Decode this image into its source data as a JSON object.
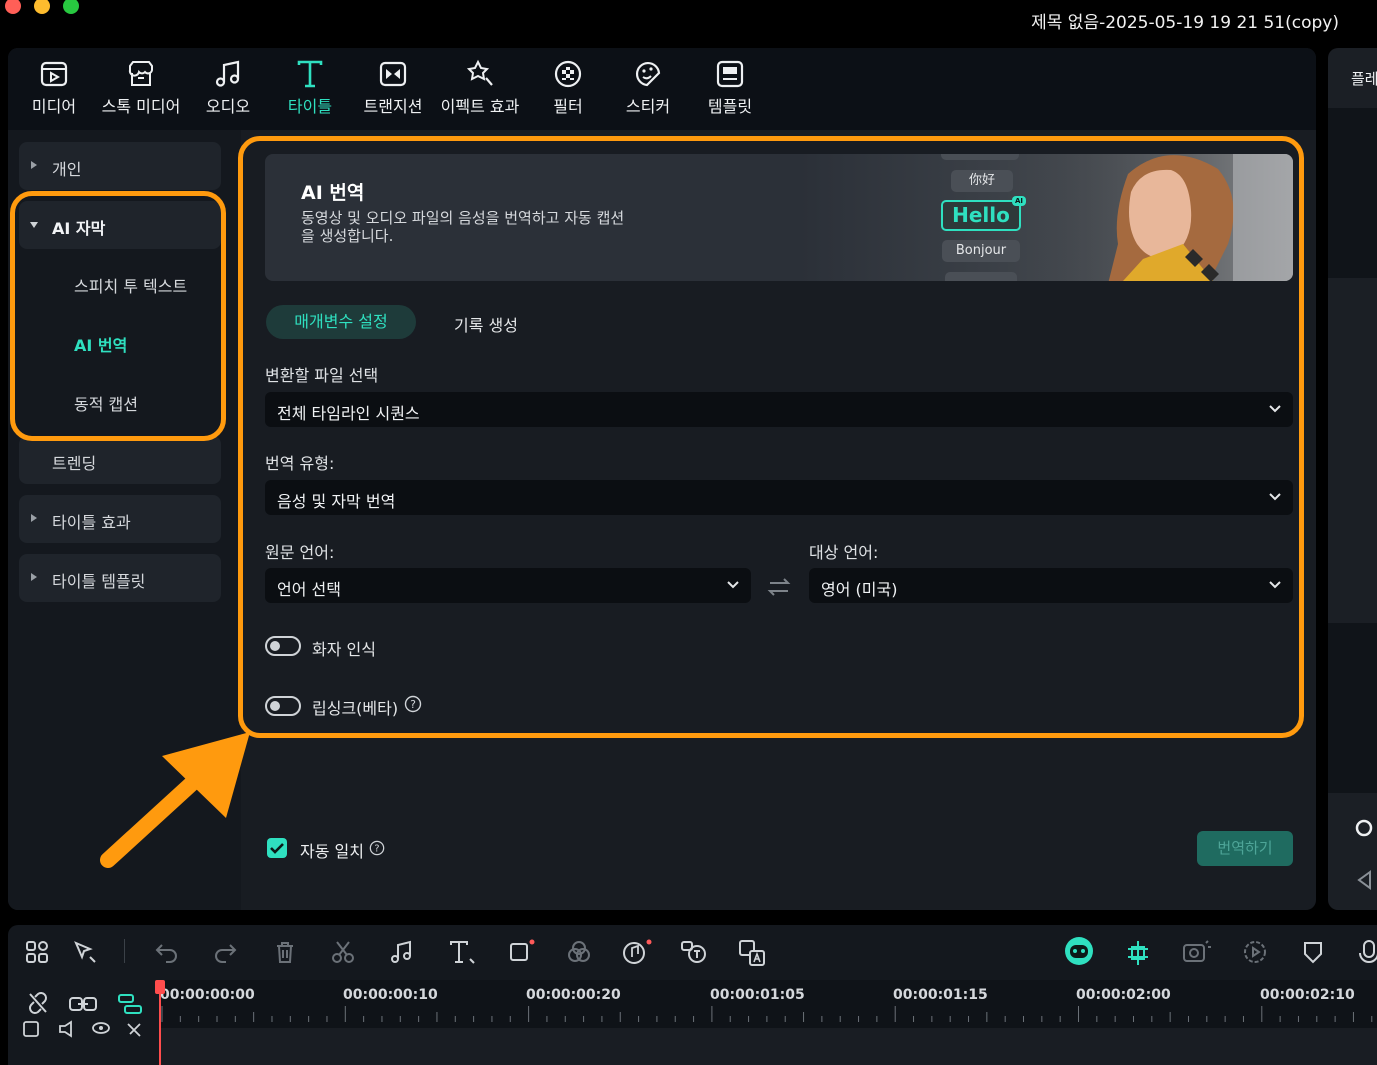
{
  "window": {
    "title": "제목 없음-2025-05-19 19 21 51(copy)"
  },
  "toolbar": {
    "items": [
      {
        "label": "미디어",
        "icon": "media-icon"
      },
      {
        "label": "스톡 미디어",
        "icon": "stock-media-icon"
      },
      {
        "label": "오디오",
        "icon": "audio-icon"
      },
      {
        "label": "타이틀",
        "icon": "title-icon",
        "active": true
      },
      {
        "label": "트랜지션",
        "icon": "transition-icon"
      },
      {
        "label": "이펙트 효과",
        "icon": "effects-icon"
      },
      {
        "label": "필터",
        "icon": "filter-icon"
      },
      {
        "label": "스티커",
        "icon": "sticker-icon"
      },
      {
        "label": "템플릿",
        "icon": "template-icon"
      }
    ]
  },
  "sidebar": {
    "personal": "개인",
    "ai_caption": "AI 자막",
    "sub_items": [
      "스피치 투 텍스트",
      "AI 번역",
      "동적 캡션"
    ],
    "trending": "트렌딩",
    "title_effects": "타이틀 효과",
    "title_templates": "타이틀 템플릿"
  },
  "hero": {
    "title": "AI 번역",
    "description": "동영상 및 오디오 파일의 음성을 번역하고 자동 캡션을 생성합니다.",
    "pills": [
      "你好",
      "Hello",
      "Bonjour"
    ],
    "ai_badge": "AI"
  },
  "tabs": {
    "active": "매개변수 설정",
    "other": "기록 생성"
  },
  "form": {
    "file_label": "변환할 파일 선택",
    "file_value": "전체 타임라인 시퀀스",
    "type_label": "번역 유형:",
    "type_value": "음성 및 자막 번역",
    "source_label": "원문 언어:",
    "source_value": "언어 선택",
    "target_label": "대상 언어:",
    "target_value": "영어 (미국)",
    "speaker_label": "화자 인식",
    "lipsync_label": "립싱크(베타)",
    "speaker_on": false,
    "lipsync_on": false
  },
  "footer": {
    "auto_match": "자동 일치",
    "auto_match_checked": true,
    "translate_button": "번역하기"
  },
  "right_panel": {
    "label": "플레"
  },
  "timeline": {
    "timecodes": [
      "00:00:00:00",
      "00:00:00:10",
      "00:00:00:20",
      "00:00:01:05",
      "00:00:01:15",
      "00:00:02:00",
      "00:00:02:10"
    ]
  },
  "colors": {
    "accent": "#2fe0c0",
    "highlight": "#ff9a0e",
    "panel": "#181c22"
  }
}
